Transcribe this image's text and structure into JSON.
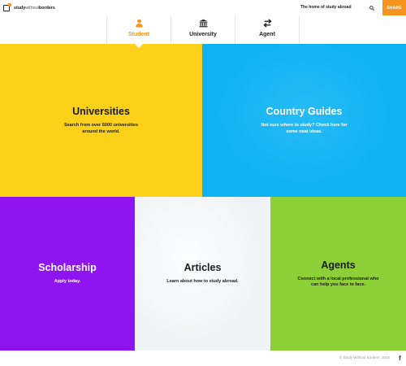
{
  "header": {
    "logo_bold": "study",
    "logo_light": "without",
    "logo_bold2": "borders",
    "tagline": "The home of study abroad",
    "share_label": "SHARE",
    "search_icon": "search-icon"
  },
  "tabs": [
    {
      "label": "Student",
      "icon": "person-icon",
      "active": true
    },
    {
      "label": "University",
      "icon": "institution-icon",
      "active": false
    },
    {
      "label": "Agent",
      "icon": "exchange-arrows-icon",
      "active": false
    }
  ],
  "tiles": {
    "universities": {
      "title": "Universities",
      "desc": "Search from over 5000 universities around the world."
    },
    "country_guides": {
      "title": "Country Guides",
      "desc": "Not sure where to study? Check here for some neat ideas."
    },
    "scholarship": {
      "title": "Scholarship",
      "desc": "Apply today."
    },
    "articles": {
      "title": "Articles",
      "desc": "Learn about how to study abroad."
    },
    "agents": {
      "title": "Agents",
      "desc": "Connect with a local professional who can help you face to face."
    }
  },
  "footer": {
    "copyright": "© Study Without Borders, 2016",
    "social_icon": "f"
  },
  "colors": {
    "accent": "#f7941d",
    "universities": "#fdd11a",
    "country_guides": "#0fb3f4",
    "scholarship": "#8f14f2",
    "articles": "#f0f3f5",
    "agents": "#8dcf36"
  }
}
